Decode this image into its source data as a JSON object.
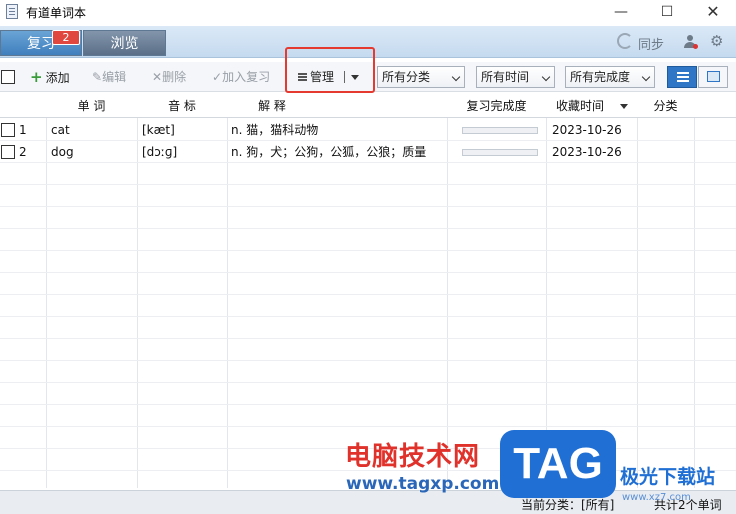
{
  "window": {
    "title": "有道单词本",
    "min_glyph": "—",
    "max_glyph": "☐",
    "close_glyph": "✕"
  },
  "tabs": {
    "review_label": "复习",
    "review_badge": "2",
    "browse_label": "浏览"
  },
  "topbar": {
    "sync_label": "同步",
    "gear_glyph": "⚙"
  },
  "toolbar": {
    "add_label": "添加",
    "edit_label": "编辑",
    "delete_label": "删除",
    "add_review_label": "加入复习",
    "manage_label": "管理",
    "edit_glyph": "✎",
    "delete_glyph": "✕",
    "add_review_glyph": "✓"
  },
  "filters": {
    "category": "所有分类",
    "time": "所有时间",
    "completion": "所有完成度"
  },
  "table": {
    "columns": [
      "单 词",
      "音 标",
      "解 释",
      "复习完成度",
      "收藏时间",
      "分类"
    ],
    "rows": [
      {
        "index": "1",
        "word": "cat",
        "phonetic": "[kæt]",
        "definition": "n. 猫，猫科动物",
        "progress": 0.08,
        "date": "2023-10-26",
        "category": ""
      },
      {
        "index": "2",
        "word": "dog",
        "phonetic": "[dɔːɡ]",
        "definition": "n. 狗，犬；公狗，公狐，公狼；质量",
        "progress": 0.08,
        "date": "2023-10-26",
        "category": ""
      }
    ]
  },
  "status": {
    "current_category": "当前分类：[所有]",
    "total": "共计2个单词"
  },
  "watermark": {
    "left_text": "电脑技术网",
    "left_url": "www.tagxp.com",
    "badge_text": "TAG",
    "right_text": "极光下载站",
    "right_url": "www.xz7.com"
  }
}
